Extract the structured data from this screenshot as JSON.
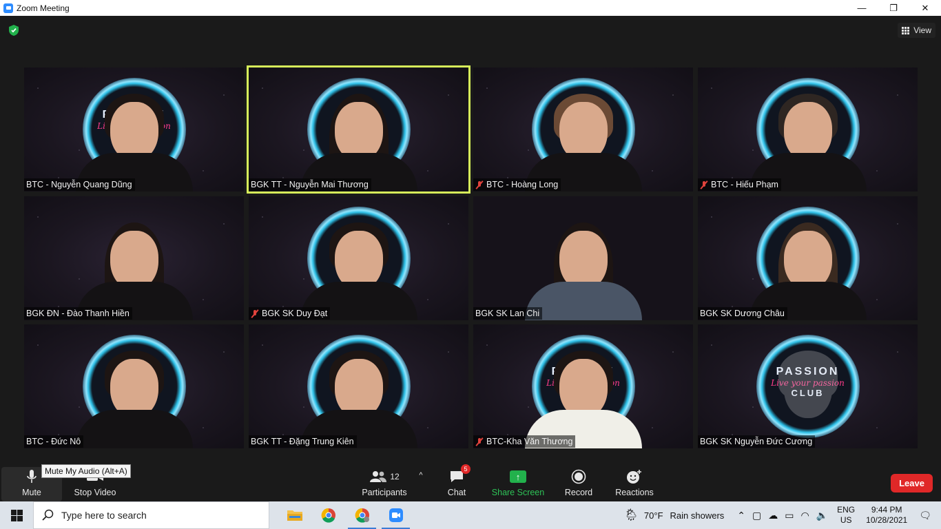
{
  "window": {
    "title": "Zoom Meeting",
    "controls": [
      "—",
      "❐",
      "✕"
    ]
  },
  "topbar": {
    "view_label": "View"
  },
  "participants": [
    {
      "name": "BTC - Nguyễn Quang Dũng",
      "muted": false,
      "active": false
    },
    {
      "name": "BGK TT - Nguyễn Mai Thương",
      "muted": false,
      "active": true
    },
    {
      "name": "BTC - Hoàng Long",
      "muted": true,
      "active": false
    },
    {
      "name": "BTC - Hiếu Phạm",
      "muted": true,
      "active": false
    },
    {
      "name": "BGK ĐN - Đào Thanh Hiền",
      "muted": false,
      "active": false
    },
    {
      "name": "BGK SK Duy Đạt",
      "muted": true,
      "active": false
    },
    {
      "name": "BGK SK Lan Chi",
      "muted": false,
      "active": false
    },
    {
      "name": "BGK SK Dương Châu",
      "muted": false,
      "active": false
    },
    {
      "name": "BTC - Đức Nô",
      "muted": false,
      "active": false
    },
    {
      "name": "BGK TT - Đặng Trung Kiên",
      "muted": false,
      "active": false
    },
    {
      "name": "BTC-Kha Văn Thương",
      "muted": true,
      "active": false
    },
    {
      "name": "BGK SK Nguyễn Đức Cương",
      "muted": false,
      "active": false
    }
  ],
  "background_logo": {
    "line1": "PASSION",
    "line2": "Live your passion",
    "line3": "CLUB"
  },
  "toolbar": {
    "mute_label": "Mute",
    "mute_tooltip": "Mute My Audio (Alt+A)",
    "stop_video_label": "Stop Video",
    "participants_label": "Participants",
    "participants_count": "12",
    "chat_label": "Chat",
    "chat_badge": "5",
    "share_label": "Share Screen",
    "record_label": "Record",
    "reactions_label": "Reactions",
    "leave_label": "Leave"
  },
  "taskbar": {
    "search_placeholder": "Type here to search",
    "weather_temp": "70°F",
    "weather_text": "Rain showers",
    "lang_1": "ENG",
    "lang_2": "US",
    "time": "9:44 PM",
    "date": "10/28/2021"
  },
  "colors": {
    "active_speaker": "#d7f05a",
    "leave": "#e02828",
    "share": "#22b14c",
    "mute_icon": "#e0423c"
  }
}
